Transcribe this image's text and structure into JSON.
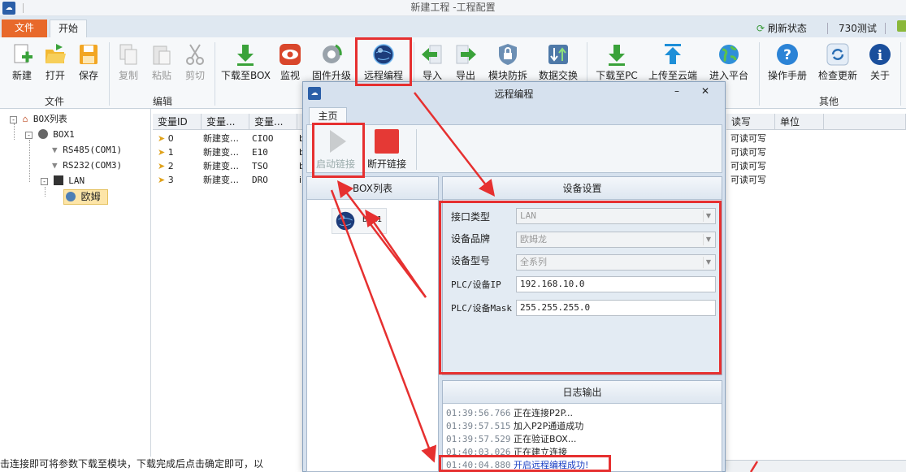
{
  "window": {
    "title": "新建工程 -工程配置"
  },
  "tabs": {
    "file": "文件",
    "start": "开始"
  },
  "status": {
    "refresh": "刷新状态",
    "user": "730测试"
  },
  "ribbon": {
    "new": "新建",
    "open": "打开",
    "save": "保存",
    "group_file": "文件",
    "copy": "复制",
    "paste": "粘贴",
    "cut": "剪切",
    "group_edit": "编辑",
    "download_box": "下载至BOX",
    "monitor": "监视",
    "firmware": "固件升级",
    "remote": "远程编程",
    "import": "导入",
    "export": "导出",
    "module_protect": "模块防拆",
    "data_exchange": "数据交换",
    "download_pc": "下载至PC",
    "upload_cloud": "上传至云端",
    "platform": "进入平台",
    "manual": "操作手册",
    "check_update": "检查更新",
    "about": "关于",
    "group_other": "其他"
  },
  "tree": {
    "root": "BOX列表",
    "box1": "BOX1",
    "rs485": "RS485(COM1)",
    "rs232": "RS232(COM3)",
    "lan": "LAN",
    "omron": "欧姆"
  },
  "grid": {
    "headers": [
      "变量ID",
      "变量...",
      "变量...",
      "读写",
      "单位"
    ],
    "rows": [
      {
        "id": "0",
        "name": "新建变…",
        "addr": "CIOO",
        "pre": "b",
        "rw": "可读可写"
      },
      {
        "id": "1",
        "name": "新建变…",
        "addr": "E10",
        "pre": "b",
        "rw": "可读可写"
      },
      {
        "id": "2",
        "name": "新建变…",
        "addr": "TSO",
        "pre": "b",
        "rw": "可读可写"
      },
      {
        "id": "3",
        "name": "新建变…",
        "addr": "DRO",
        "pre": "i",
        "rw": "可读可写"
      }
    ]
  },
  "dialog": {
    "title": "远程编程",
    "tab": "主页",
    "start_link": "启动链接",
    "stop_link": "断开链接",
    "box_list_title": "BOX列表",
    "box_item": "BOX1",
    "device_settings": "设备设置",
    "interface_label": "接口类型",
    "interface_value": "LAN",
    "brand_label": "设备品牌",
    "brand_value": "欧姆龙",
    "model_label": "设备型号",
    "model_value": "全系列",
    "ip_label": "PLC/设备IP",
    "ip_value": "192.168.10.0",
    "mask_label": "PLC/设备Mask",
    "mask_value": "255.255.255.0",
    "log_title": "日志输出",
    "log": [
      {
        "time": "01:39:56.766",
        "msg": "正在连接P2P..."
      },
      {
        "time": "01:39:57.515",
        "msg": "加入P2P通道成功"
      },
      {
        "time": "01:39:57.529",
        "msg": "正在验证BOX..."
      },
      {
        "time": "01:40:03.026",
        "msg": "正在建立连接"
      },
      {
        "time": "01:40:04.880",
        "msg": "开启远程编程成功!"
      }
    ]
  },
  "bottom_text": "击连接即可将参数下载至模块，下载完成后点击确定即可，以",
  "colors": {
    "accent_red": "#e63030",
    "file_tab": "#e8692b",
    "success_blue": "#1a3fc4"
  }
}
